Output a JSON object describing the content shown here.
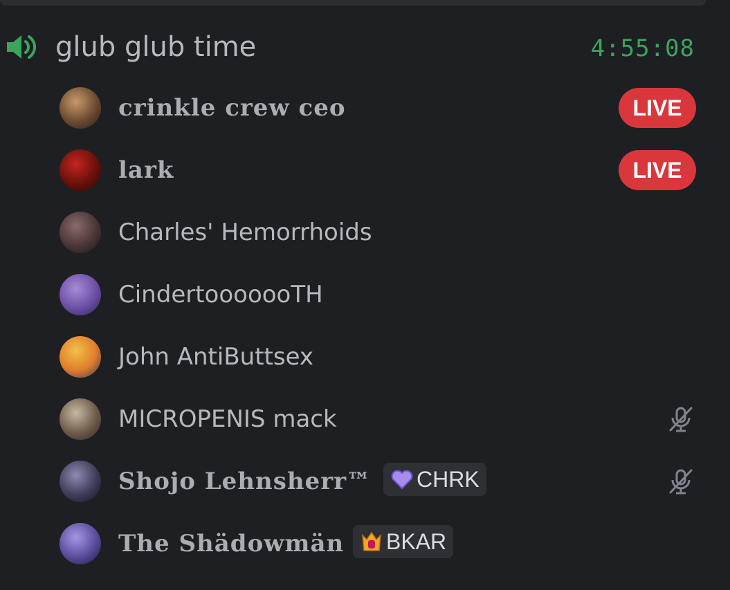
{
  "channel": {
    "name": "glub glub time",
    "timer": "4:55:08",
    "icon": "speaker-icon",
    "timer_color": "#3ba55d"
  },
  "members": [
    {
      "name": "crinkle crew ceo",
      "style": "gothic",
      "live_label": "LIVE",
      "avatar_colors": [
        "#c89a6a",
        "#6b4a33",
        "#2a1d17"
      ]
    },
    {
      "name": "lark",
      "style": "gothic",
      "live_label": "LIVE",
      "avatar_colors": [
        "#c4261e",
        "#6a100c",
        "#2a0605"
      ]
    },
    {
      "name": "Charles' Hemorrhoids",
      "style": "plain",
      "avatar_colors": [
        "#8a6a6a",
        "#4a3636",
        "#1c1414"
      ]
    },
    {
      "name": "CindertooooooTH",
      "style": "plain",
      "avatar_colors": [
        "#a78bd6",
        "#6b4fa5",
        "#2e2150"
      ]
    },
    {
      "name": "John AntiButtsex",
      "style": "plain",
      "avatar_colors": [
        "#f2c14a",
        "#e07b2b",
        "#2b3a64"
      ]
    },
    {
      "name": "MICROPENIS mack",
      "style": "plain",
      "muted_icon": "mic-muted-icon",
      "avatar_colors": [
        "#c9b8a0",
        "#6e5c4b",
        "#2b2520"
      ]
    },
    {
      "name": "Shojo Lehnsherr™",
      "style": "gothic",
      "muted_icon": "mic-muted-icon",
      "tag": {
        "label": "CHRK",
        "icon": "purple-heart-icon",
        "color": "#a98bf0"
      },
      "avatar_colors": [
        "#8c8ab0",
        "#3f3d5a",
        "#151420"
      ]
    },
    {
      "name": "The Shädowmän",
      "style": "gothic",
      "tag": {
        "label": "BKAR",
        "icon": "crown-gem-icon",
        "color": "#f5a623"
      },
      "avatar_colors": [
        "#a795e6",
        "#5a4c9a",
        "#1a1630"
      ]
    }
  ],
  "colors": {
    "background": "#1e1f22",
    "text": "#b5bac1",
    "live": "#da373c"
  }
}
